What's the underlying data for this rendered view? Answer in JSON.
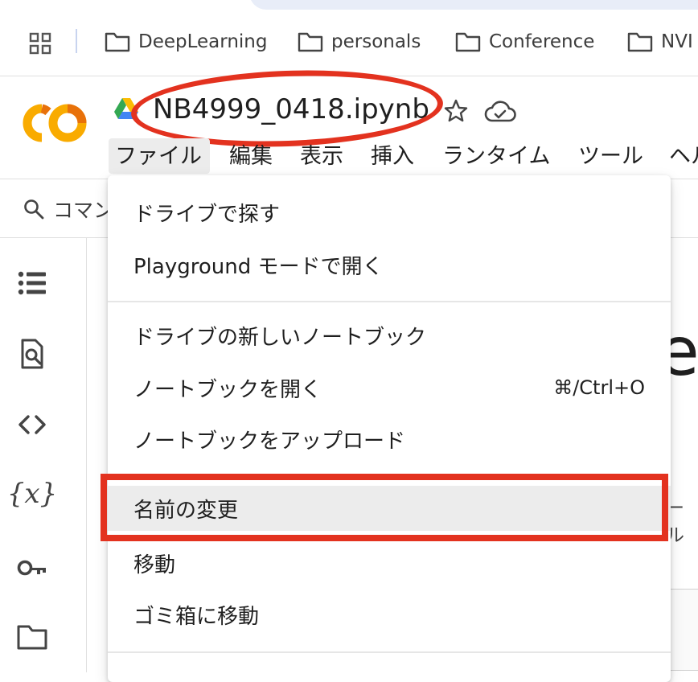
{
  "bookmarks": {
    "items": [
      {
        "label": "DeepLearning"
      },
      {
        "label": "personals"
      },
      {
        "label": "Conference"
      },
      {
        "label": "NVI"
      }
    ]
  },
  "notebook": {
    "title": "NB4999_0418.ipynb"
  },
  "menubar": {
    "items": [
      {
        "label": "ファイル"
      },
      {
        "label": "編集"
      },
      {
        "label": "表示"
      },
      {
        "label": "挿入"
      },
      {
        "label": "ランタイム"
      },
      {
        "label": "ツール"
      },
      {
        "label": "ヘル"
      }
    ]
  },
  "command_search": {
    "label": "コマン"
  },
  "file_menu": {
    "items": [
      {
        "label": "ドライブで探す"
      },
      {
        "label": "Playground モードで開く"
      },
      {
        "label": "ドライブの新しいノートブック"
      },
      {
        "label": "ノートブックを開く",
        "shortcut": "⌘/Ctrl+O"
      },
      {
        "label": "ノートブックをアップロード"
      },
      {
        "label": "名前の変更",
        "highlighted": true
      },
      {
        "label": "移動"
      },
      {
        "label": "ゴミ箱に移動"
      }
    ]
  },
  "background": {
    "heading_fragment": "e",
    "tool_fragment": "ール"
  },
  "sidebar": {
    "icons": [
      "toc-icon",
      "find-icon",
      "code-snippets-icon",
      "variables-icon",
      "secrets-key-icon",
      "files-folder-icon"
    ],
    "variables_glyph": "{x}"
  },
  "colors": {
    "annotation_red": "#e3321f",
    "menu_hover": "#ececec",
    "colab_orange": "#f9ab00",
    "colab_dark_orange": "#e8710a"
  }
}
